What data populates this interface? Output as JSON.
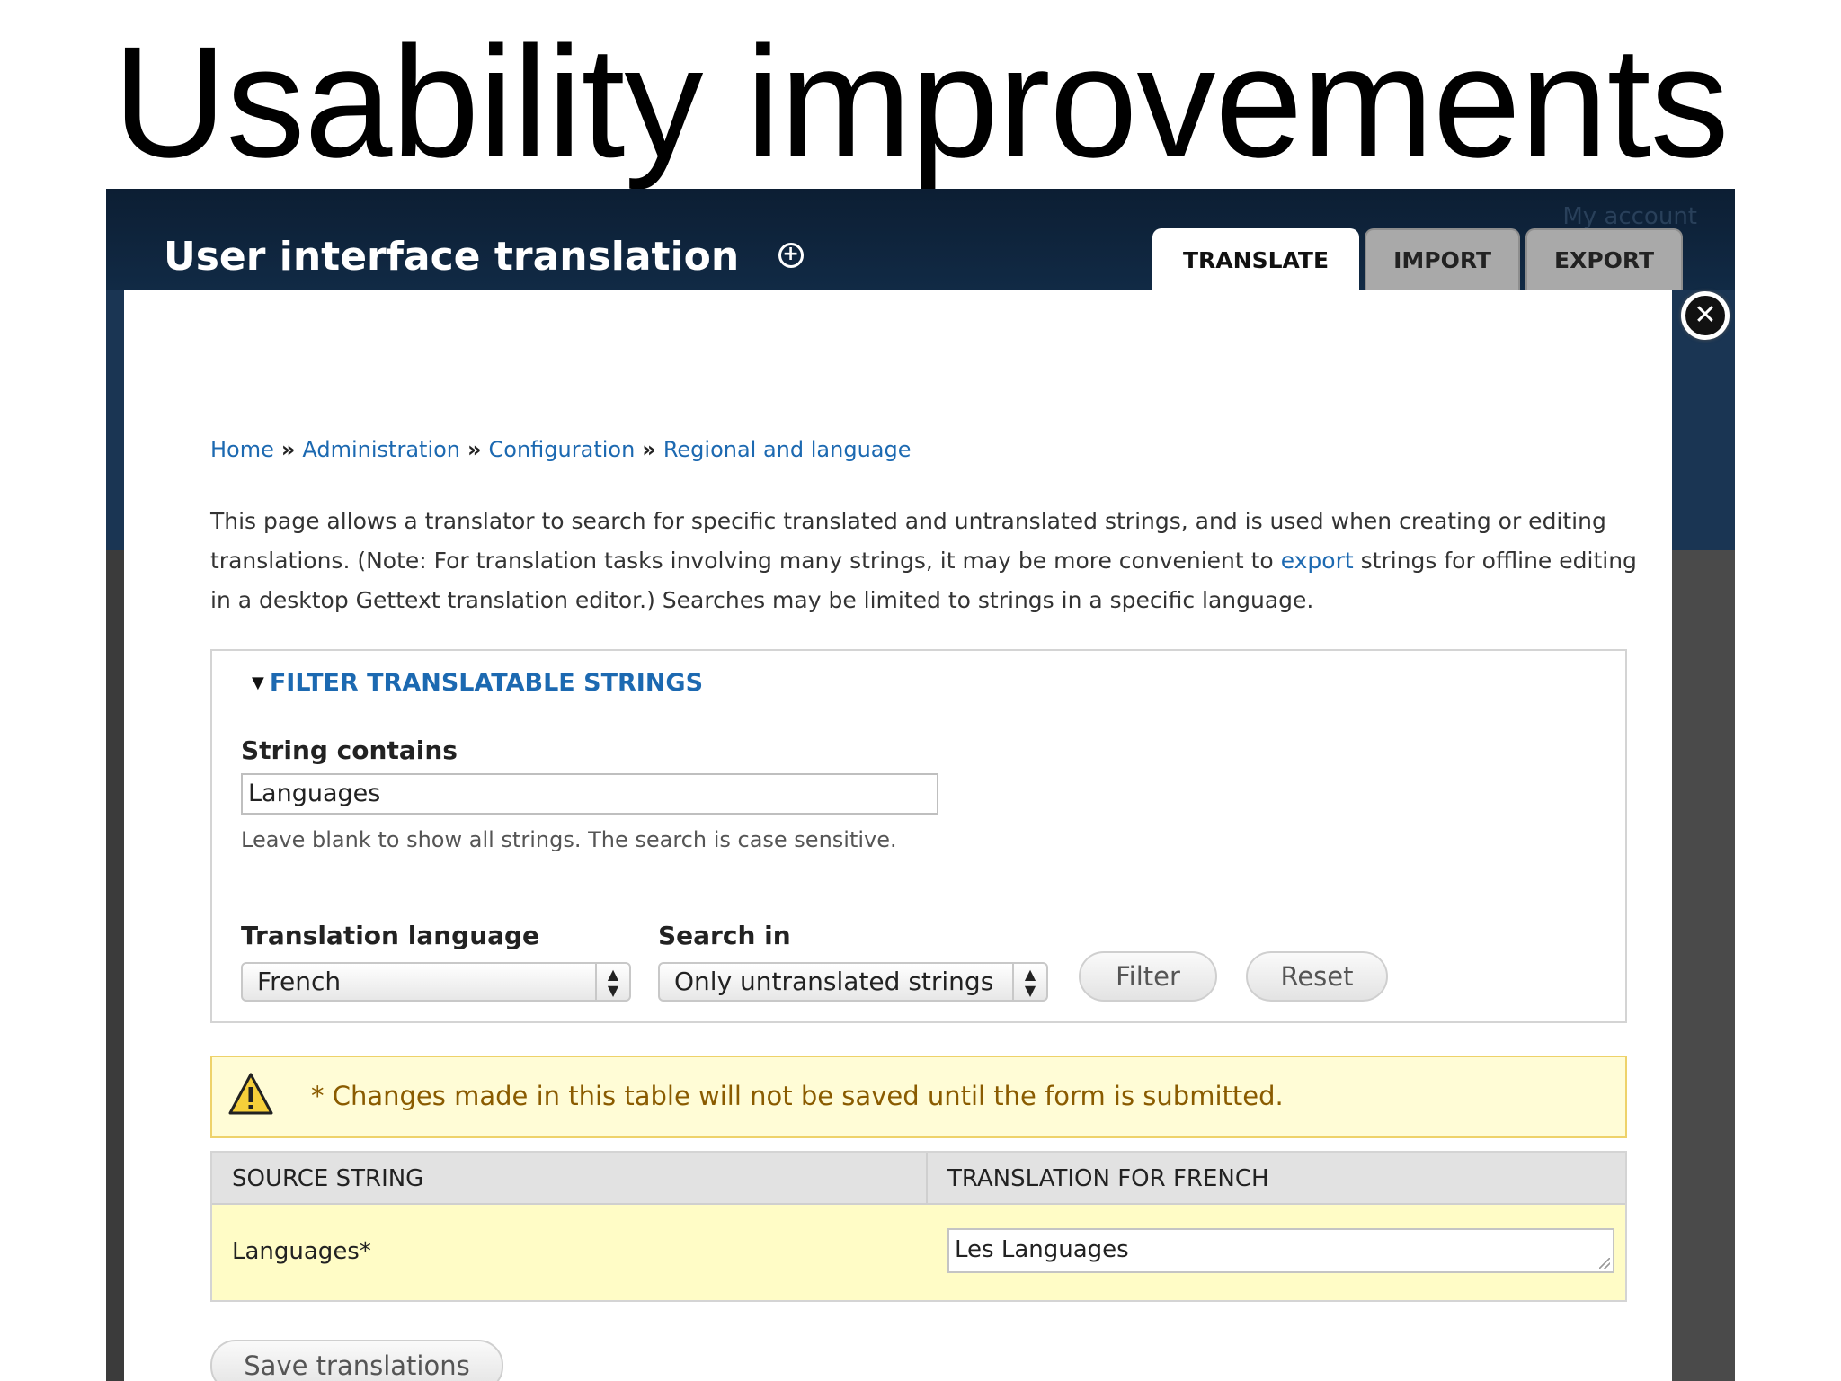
{
  "slide": {
    "title": "Usability improvements"
  },
  "header": {
    "account_link": "My account",
    "page_title": "User interface translation",
    "shortcut_symbol": "+",
    "tabs": [
      {
        "label": "TRANSLATE",
        "active": true
      },
      {
        "label": "IMPORT",
        "active": false
      },
      {
        "label": "EXPORT",
        "active": false
      }
    ]
  },
  "overlay": {
    "close_symbol": "✕"
  },
  "breadcrumb": {
    "separator": "»",
    "items": [
      "Home",
      "Administration",
      "Configuration",
      "Regional and language"
    ]
  },
  "description": {
    "part1": "This page allows a translator to search for specific translated and untranslated strings, and is used when creating or editing translations. (Note: For translation tasks involving many strings, it may be more convenient to ",
    "link": "export",
    "part2": " strings for offline editing in a desktop Gettext translation editor.) Searches may be limited to strings in a specific language."
  },
  "filter": {
    "legend": "FILTER TRANSLATABLE STRINGS",
    "string_label": "String contains",
    "string_value": "Languages",
    "string_hint": "Leave blank to show all strings. The search is case sensitive.",
    "language_label": "Translation language",
    "language_value": "French",
    "search_label": "Search in",
    "search_value": "Only untranslated strings",
    "filter_button": "Filter",
    "reset_button": "Reset"
  },
  "warning": {
    "text": "* Changes made in this table will not be saved until the form is submitted."
  },
  "table": {
    "headers": [
      "SOURCE STRING",
      "TRANSLATION FOR FRENCH"
    ],
    "rows": [
      {
        "source": "Languages*",
        "translation": "Les Languages"
      }
    ]
  },
  "actions": {
    "save_button": "Save translations"
  },
  "colors": {
    "header_bg": "#0c1e33",
    "link": "#1c69b1",
    "warning_bg": "#fffcd6",
    "warning_border": "#eed26a",
    "row_highlight": "#fffcc6"
  }
}
